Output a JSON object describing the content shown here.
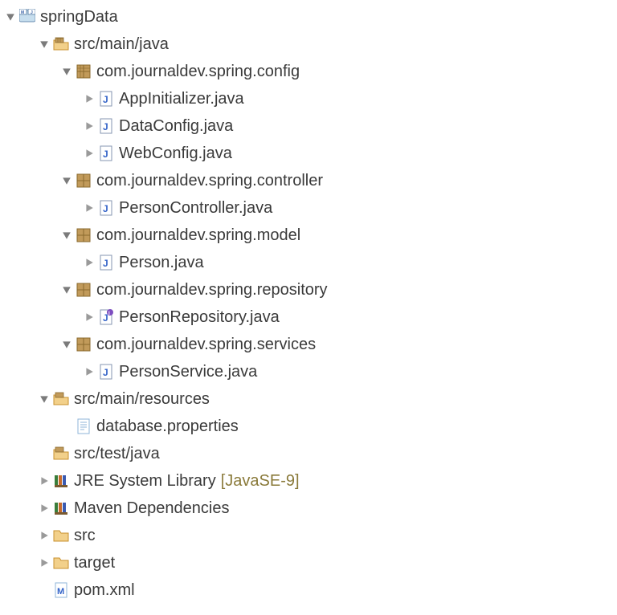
{
  "project": {
    "name": "springData"
  },
  "srcMainJava": {
    "label": "src/main/java",
    "packages": {
      "config": {
        "label": "com.journaldev.spring.config",
        "files": [
          {
            "name": "AppInitializer.java"
          },
          {
            "name": "DataConfig.java"
          },
          {
            "name": "WebConfig.java"
          }
        ]
      },
      "controller": {
        "label": "com.journaldev.spring.controller",
        "files": [
          {
            "name": "PersonController.java"
          }
        ]
      },
      "model": {
        "label": "com.journaldev.spring.model",
        "files": [
          {
            "name": "Person.java"
          }
        ]
      },
      "repository": {
        "label": "com.journaldev.spring.repository",
        "files": [
          {
            "name": "PersonRepository.java"
          }
        ]
      },
      "services": {
        "label": "com.journaldev.spring.services",
        "files": [
          {
            "name": "PersonService.java"
          }
        ]
      }
    }
  },
  "srcMainResources": {
    "label": "src/main/resources",
    "files": [
      {
        "name": "database.properties"
      }
    ]
  },
  "srcTestJava": {
    "label": "src/test/java"
  },
  "jre": {
    "label": "JRE System Library",
    "decor": "[JavaSE-9]"
  },
  "maven": {
    "label": "Maven Dependencies"
  },
  "srcFolder": {
    "label": "src"
  },
  "targetFolder": {
    "label": "target"
  },
  "pom": {
    "label": "pom.xml"
  }
}
